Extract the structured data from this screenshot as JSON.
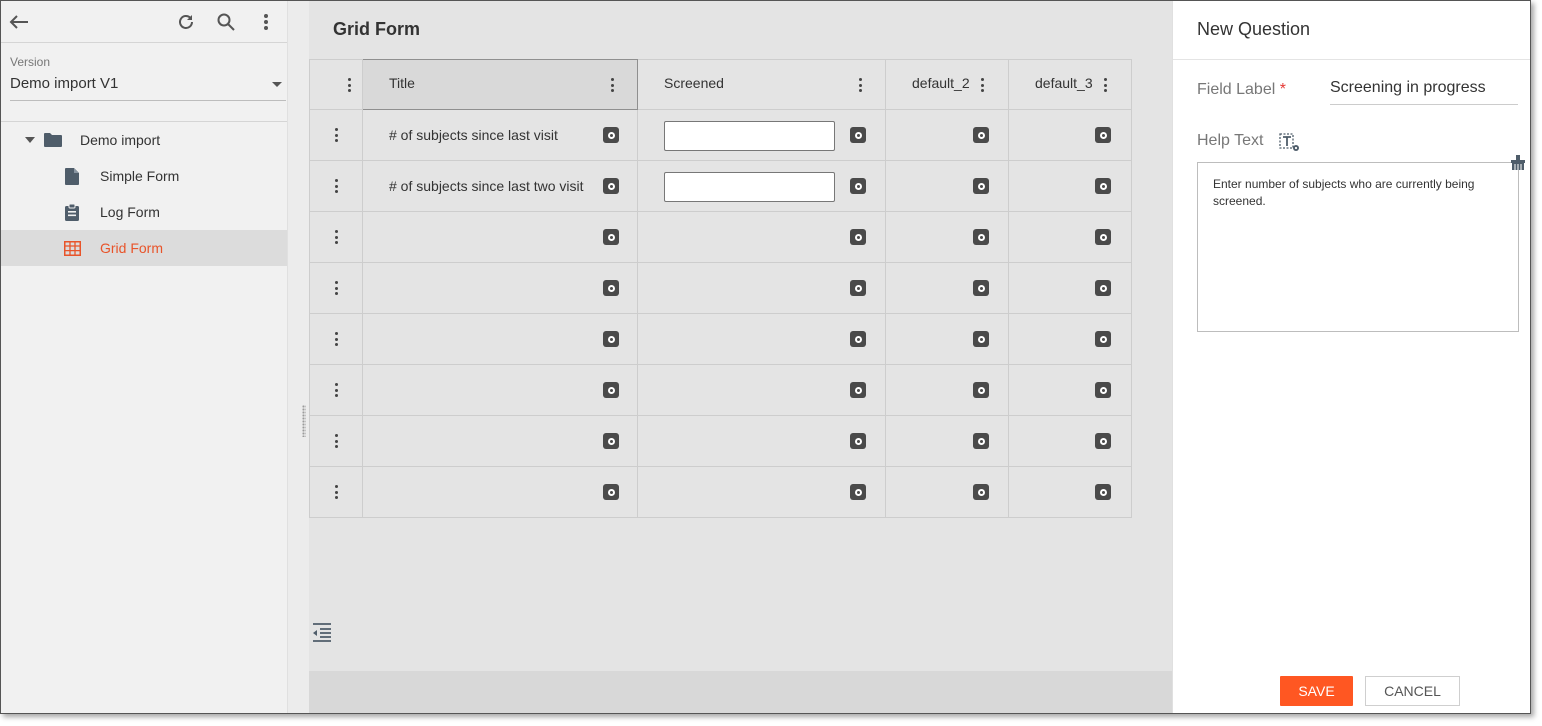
{
  "sidebar": {
    "top_icons": [
      "back-arrow-icon",
      "refresh-icon",
      "search-icon",
      "more-vert-icon"
    ],
    "version": {
      "label": "Version",
      "value": "Demo import V1"
    },
    "tree": {
      "folder": {
        "label": "Demo import",
        "icon": "folder-icon"
      },
      "items": [
        {
          "label": "Simple Form",
          "icon": "document-icon",
          "active": false
        },
        {
          "label": "Log Form",
          "icon": "clipboard-icon",
          "active": false
        },
        {
          "label": "Grid Form",
          "icon": "grid-icon",
          "active": true
        }
      ]
    }
  },
  "main": {
    "title": "Grid Form",
    "columns": [
      "Title",
      "Screened",
      "default_2",
      "default_3"
    ],
    "rows": [
      {
        "title": "# of subjects since last visit",
        "screened_input": true
      },
      {
        "title": "# of subjects since last two visit",
        "screened_input": true
      },
      {
        "title": "",
        "screened_input": false
      },
      {
        "title": "",
        "screened_input": false
      },
      {
        "title": "",
        "screened_input": false
      },
      {
        "title": "",
        "screened_input": false
      },
      {
        "title": "",
        "screened_input": false
      },
      {
        "title": "",
        "screened_input": false
      }
    ]
  },
  "panel": {
    "title": "New Question",
    "field_label": {
      "label": "Field Label",
      "required_mark": "*",
      "value": "Screening in progress"
    },
    "help_text": {
      "label": "Help Text",
      "value": "Enter number of subjects who are currently being screened."
    },
    "save_label": "SAVE",
    "cancel_label": "CANCEL"
  },
  "colors": {
    "accent": "#ff5722",
    "active_item": "#e8542a"
  }
}
